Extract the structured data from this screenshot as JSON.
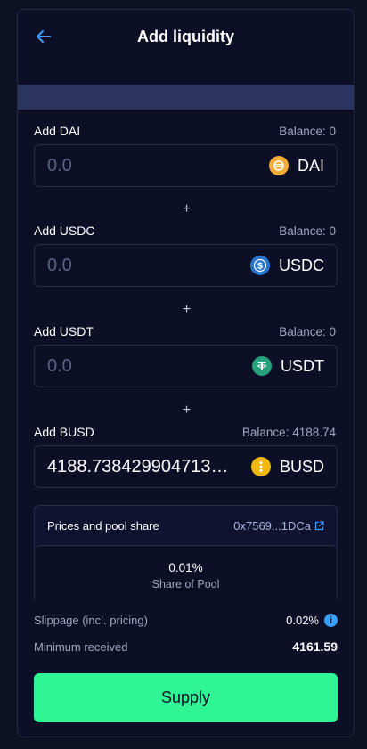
{
  "header": {
    "title": "Add liquidity"
  },
  "fields": [
    {
      "label": "Add DAI",
      "balance": "Balance: 0",
      "amount": "0.0",
      "token": "DAI",
      "icon": "dai-icon",
      "color": "#f5ac37"
    },
    {
      "label": "Add USDC",
      "balance": "Balance: 0",
      "amount": "0.0",
      "token": "USDC",
      "icon": "usdc-icon",
      "color": "#2775ca"
    },
    {
      "label": "Add USDT",
      "balance": "Balance: 0",
      "amount": "0.0",
      "token": "USDT",
      "icon": "usdt-icon",
      "color": "#26a17b"
    },
    {
      "label": "Add BUSD",
      "balance": "Balance: 4188.74",
      "amount": "4188.738429904713…",
      "token": "BUSD",
      "icon": "busd-icon",
      "color": "#f0b90b"
    }
  ],
  "plus": "+",
  "pool": {
    "title": "Prices and pool share",
    "address": "0x7569...1DCa",
    "share_value": "0.01%",
    "share_label": "Share of Pool"
  },
  "slippage": {
    "label": "Slippage (incl. pricing)",
    "value": "0.02%"
  },
  "minimum": {
    "label": "Minimum received",
    "value": "4161.59"
  },
  "supply_label": "Supply",
  "colors": {
    "accent": "#2ff594",
    "background": "#0c0f26",
    "banner": "#2b345f",
    "link": "#3aa0ff"
  }
}
